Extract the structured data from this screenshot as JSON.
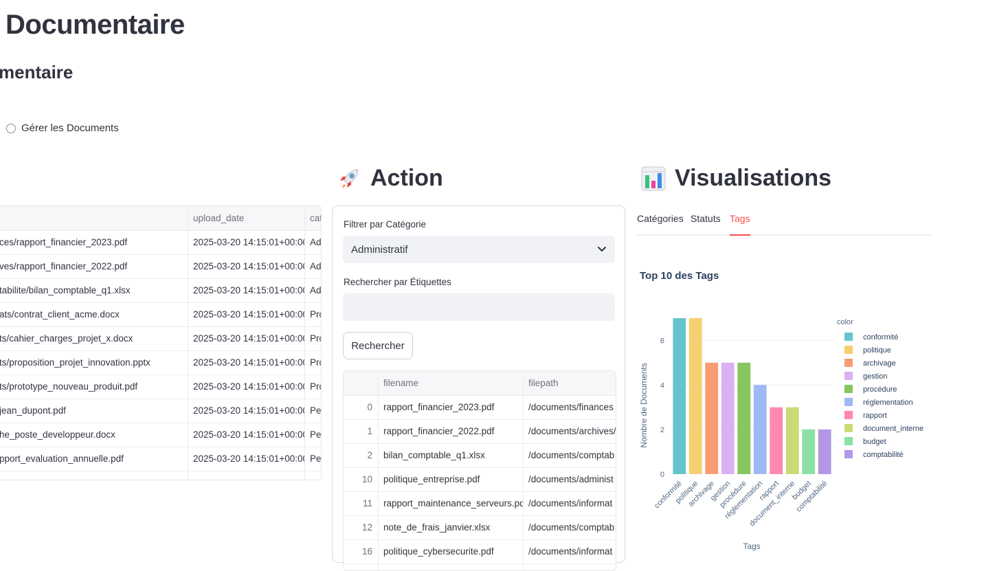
{
  "page": {
    "title": "Documentaire",
    "subtitle": "mentaire",
    "radio_option": "Gérer les Documents"
  },
  "action": {
    "heading": "Action",
    "heading_icon": "rocket-icon",
    "filter_label": "Filtrer par Catégorie",
    "filter_value": "Administratif",
    "search_label": "Rechercher par Étiquettes",
    "search_value": "",
    "search_button": "Rechercher",
    "table": {
      "columns": [
        "",
        "filename",
        "filepath"
      ],
      "rows": [
        [
          "0",
          "rapport_financier_2023.pdf",
          "/documents/finances"
        ],
        [
          "1",
          "rapport_financier_2022.pdf",
          "/documents/archives/"
        ],
        [
          "2",
          "bilan_comptable_q1.xlsx",
          "/documents/comptab"
        ],
        [
          "10",
          "politique_entreprise.pdf",
          "/documents/administ"
        ],
        [
          "11",
          "rapport_maintenance_serveurs.pdf",
          "/documents/informat"
        ],
        [
          "12",
          "note_de_frais_janvier.xlsx",
          "/documents/comptab"
        ],
        [
          "16",
          "politique_cybersecurite.pdf",
          "/documents/informat"
        ]
      ]
    }
  },
  "documents_table": {
    "columns": [
      "",
      "upload_date",
      "cat"
    ],
    "rows": [
      [
        "ces/rapport_financier_2023.pdf",
        "2025-03-20 14:15:01+00:00",
        "Ad"
      ],
      [
        "ves/rapport_financier_2022.pdf",
        "2025-03-20 14:15:01+00:00",
        "Ad"
      ],
      [
        "tabilite/bilan_comptable_q1.xlsx",
        "2025-03-20 14:15:01+00:00",
        "Ad"
      ],
      [
        "ats/contrat_client_acme.docx",
        "2025-03-20 14:15:01+00:00",
        "Pro"
      ],
      [
        "ts/cahier_charges_projet_x.docx",
        "2025-03-20 14:15:01+00:00",
        "Pro"
      ],
      [
        "ts/proposition_projet_innovation.pptx",
        "2025-03-20 14:15:01+00:00",
        "Pro"
      ],
      [
        "ts/prototype_nouveau_produit.pdf",
        "2025-03-20 14:15:01+00:00",
        "Pro"
      ],
      [
        "jean_dupont.pdf",
        "2025-03-20 14:15:01+00:00",
        "Pe"
      ],
      [
        "he_poste_developpeur.docx",
        "2025-03-20 14:15:01+00:00",
        "Pe"
      ],
      [
        "pport_evaluation_annuelle.pdf",
        "2025-03-20 14:15:01+00:00",
        "Pe"
      ]
    ]
  },
  "visualisations": {
    "heading": "Visualisations",
    "heading_icon": "bar-chart-icon",
    "tabs": [
      "Catégories",
      "Statuts",
      "Tags"
    ],
    "active_tab": "Tags"
  },
  "chart_data": {
    "type": "bar",
    "title": "Top 10 des Tags",
    "xlabel": "Tags",
    "ylabel": "Nombre de Documents",
    "legend_title": "color",
    "legend_position": "right",
    "grid": true,
    "ylim": [
      0,
      7.4
    ],
    "yticks": [
      0,
      2,
      4,
      6
    ],
    "categories": [
      "conformité",
      "politique",
      "archivage",
      "gestion",
      "procédure",
      "réglementation",
      "rapport",
      "document_interne",
      "budget",
      "comptabilité"
    ],
    "values": [
      7,
      7,
      5,
      5,
      5,
      4,
      3,
      3,
      2,
      2
    ],
    "colors": [
      "#66c5cc",
      "#f6cf71",
      "#f89c74",
      "#dcb0f2",
      "#87c55f",
      "#9eb9f3",
      "#fe88b1",
      "#c9db74",
      "#8be0a4",
      "#b497e7"
    ]
  }
}
